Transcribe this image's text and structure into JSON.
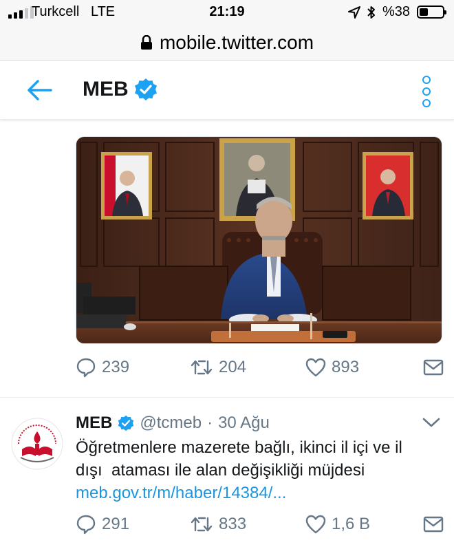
{
  "status_bar": {
    "carrier": "Turkcell",
    "network": "LTE",
    "time": "21:19",
    "battery": "%38",
    "battery_level": 0.38
  },
  "browser": {
    "url": "mobile.twitter.com"
  },
  "header": {
    "title": "MEB"
  },
  "tweet1": {
    "stats": {
      "replies": "239",
      "retweets": "204",
      "likes": "893"
    }
  },
  "tweet2": {
    "name": "MEB",
    "handle": "@tcmeb",
    "separator": "·",
    "date": "30 Ağu",
    "text_line1": "Öğretmenlere mazerete bağlı, ikinci il içi ve il",
    "text_line2": "dışı  ataması ile alan değişikliği müjdesi",
    "link": "meb.gov.tr/m/haber/14384/...",
    "stats": {
      "replies": "291",
      "retweets": "833",
      "likes": "1,6 B"
    }
  },
  "colors": {
    "accent": "#1da1f2",
    "link": "#1b95e0",
    "muted": "#657786",
    "verified": "#1da1f2"
  }
}
